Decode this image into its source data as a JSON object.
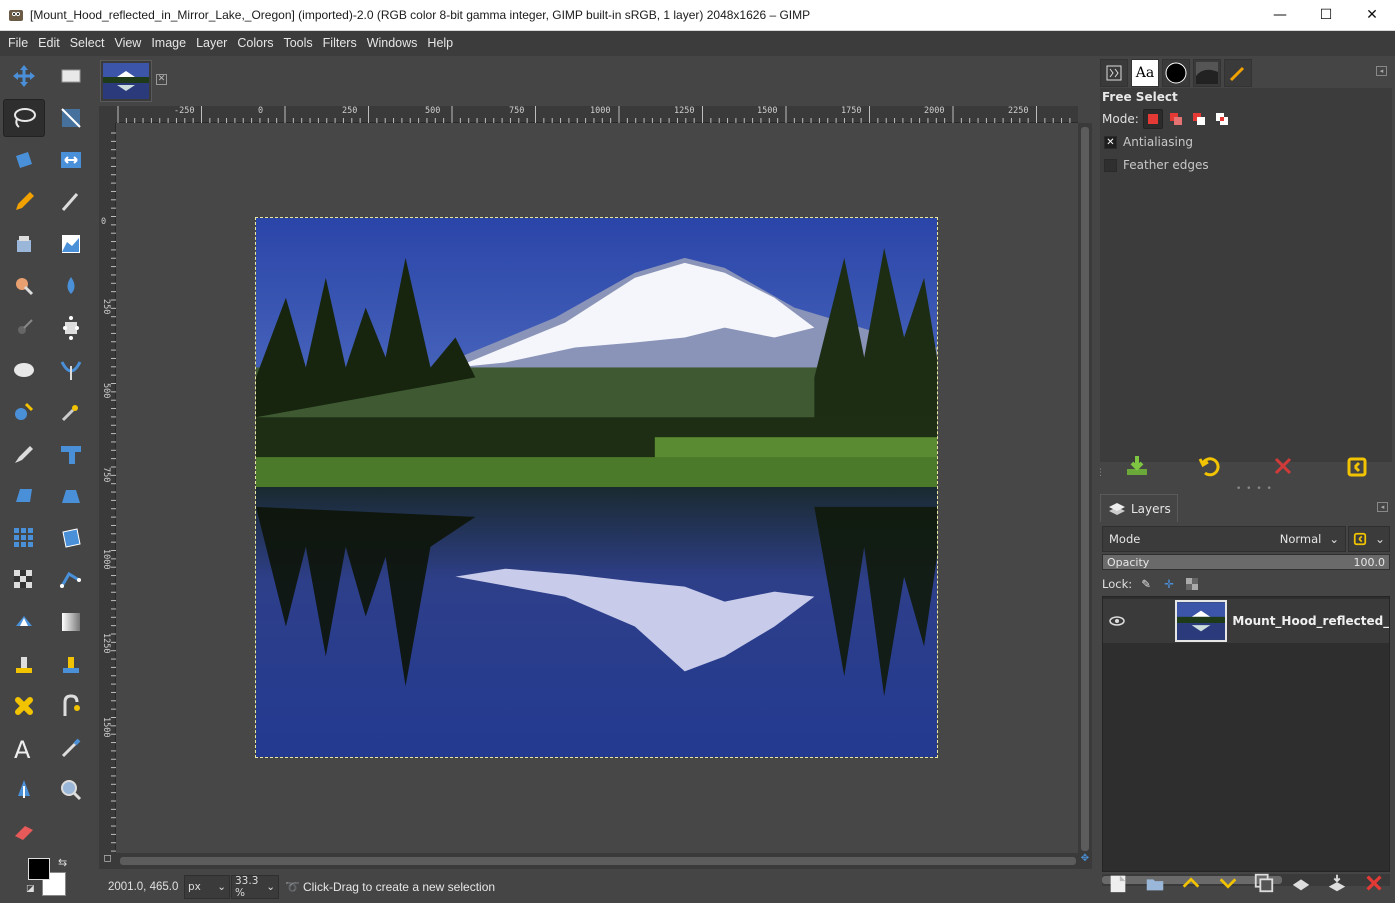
{
  "window": {
    "title": "[Mount_Hood_reflected_in_Mirror_Lake,_Oregon] (imported)-2.0 (RGB color 8-bit gamma integer, GIMP built-in sRGB, 1 layer) 2048x1626 – GIMP",
    "minimize": "—",
    "maximize": "☐",
    "close": "✕"
  },
  "menubar": [
    "File",
    "Edit",
    "Select",
    "View",
    "Image",
    "Layer",
    "Colors",
    "Tools",
    "Filters",
    "Windows",
    "Help"
  ],
  "toolbox": {
    "active_tool": "free-select",
    "tools": [
      "move-tool-icon",
      "rect-select-tool-icon",
      "free-select-tool-icon",
      "crop-tool-icon",
      "unified-transform-tool-icon",
      "flip-tool-icon",
      "pencil-tool-icon",
      "smudge-tool-icon",
      "bucket-fill-tool-icon",
      "levels-tool-icon",
      "dodge-burn-tool-icon",
      "blur-tool-icon",
      "path-point-tool-icon",
      "handle-transform-tool-icon",
      "ellipse-select-tool-icon",
      "warp-tool-icon",
      "fuzzy-select-tool-icon",
      "brightness-tool-icon",
      "paintbrush-tool-icon",
      "scale-tool-icon",
      "perspective-tool-icon",
      "shear-tool-icon",
      "grid-transform-tool-icon",
      "cage-tool-icon",
      "checker-tool-icon",
      "n-point-deformation-tool-icon",
      "paths-tool-icon",
      "gradient-tool-icon",
      "clone-tool-icon",
      "heal-tool-icon",
      "mypaint-tool-icon",
      "measure-tool-icon",
      "text-tool-icon",
      "color-picker-tool-icon",
      "ink-tool-icon",
      "zoom-tool-icon",
      "eraser-tool-icon"
    ],
    "fg_color": "#000000",
    "bg_color": "#ffffff"
  },
  "rulers": {
    "horizontal_labels": [
      "-250",
      "0",
      "250",
      "500",
      "750",
      "1000",
      "1250",
      "1500",
      "1750",
      "2000",
      "2250"
    ],
    "vertical_labels": [
      "0",
      "250",
      "500",
      "750",
      "1000",
      "1250",
      "1500"
    ]
  },
  "statusbar": {
    "coords": "2001.0, 465.0",
    "unit": "px",
    "zoom": "33.3 %",
    "message": "Click-Drag to create a new selection"
  },
  "tool_options": {
    "title": "Free Select",
    "mode_label": "Mode:",
    "antialiasing_label": "Antialiasing",
    "antialiasing_checked": true,
    "feather_label": "Feather edges",
    "feather_checked": false
  },
  "layers_dock": {
    "tab_label": "Layers",
    "mode_label": "Mode",
    "mode_value": "Normal",
    "opacity_label": "Opacity",
    "opacity_value": "100.0",
    "lock_label": "Lock:",
    "layers": [
      {
        "name": "Mount_Hood_reflected_in_Mirror_Lake,_Oregon",
        "visible": true
      }
    ]
  },
  "colors": {
    "accent_green": "#7ec542",
    "accent_red": "#d23a3a",
    "accent_yellow": "#f2c300",
    "accent_blue": "#4a90d9"
  }
}
